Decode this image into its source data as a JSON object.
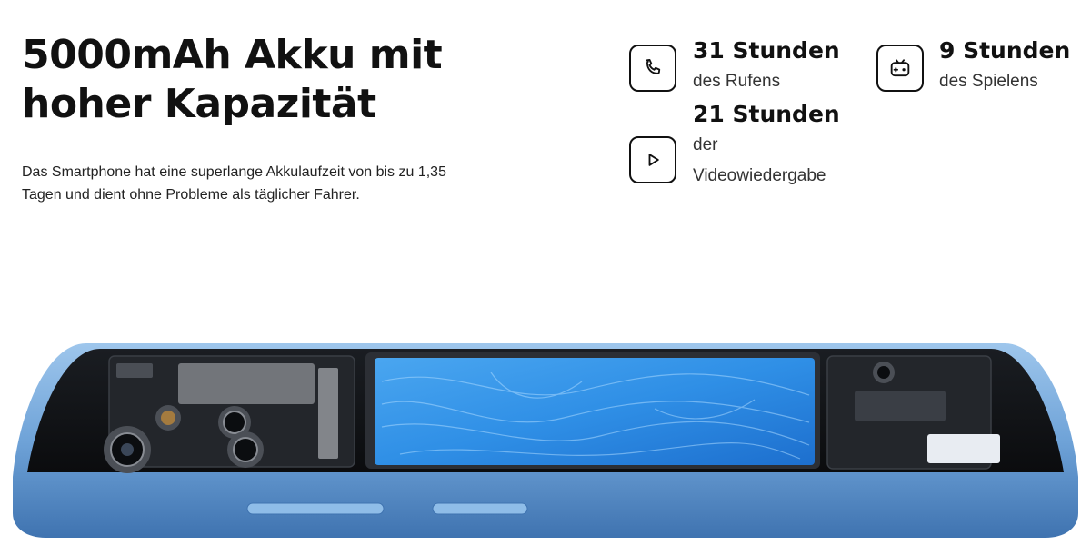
{
  "headline": {
    "line1": "5000mAh Akku mit",
    "line2": "hoher Kapazität"
  },
  "description": "Das Smartphone hat eine superlange Akkulaufzeit von bis zu 1,35 Tagen und dient ohne Probleme als täglicher Fahrer.",
  "stats": [
    {
      "icon": "phone-icon",
      "value": "31 Stunden",
      "label": "des Rufens"
    },
    {
      "icon": "play-icon",
      "value": "21 Stunden",
      "label": "der Videowiedergabe"
    },
    {
      "icon": "gamepad-icon",
      "value": "9 Stunden",
      "label": "des Spielens"
    }
  ],
  "colors": {
    "text": "#111111",
    "frame": "#6fa3d8",
    "battery": "#2f8fe6"
  }
}
